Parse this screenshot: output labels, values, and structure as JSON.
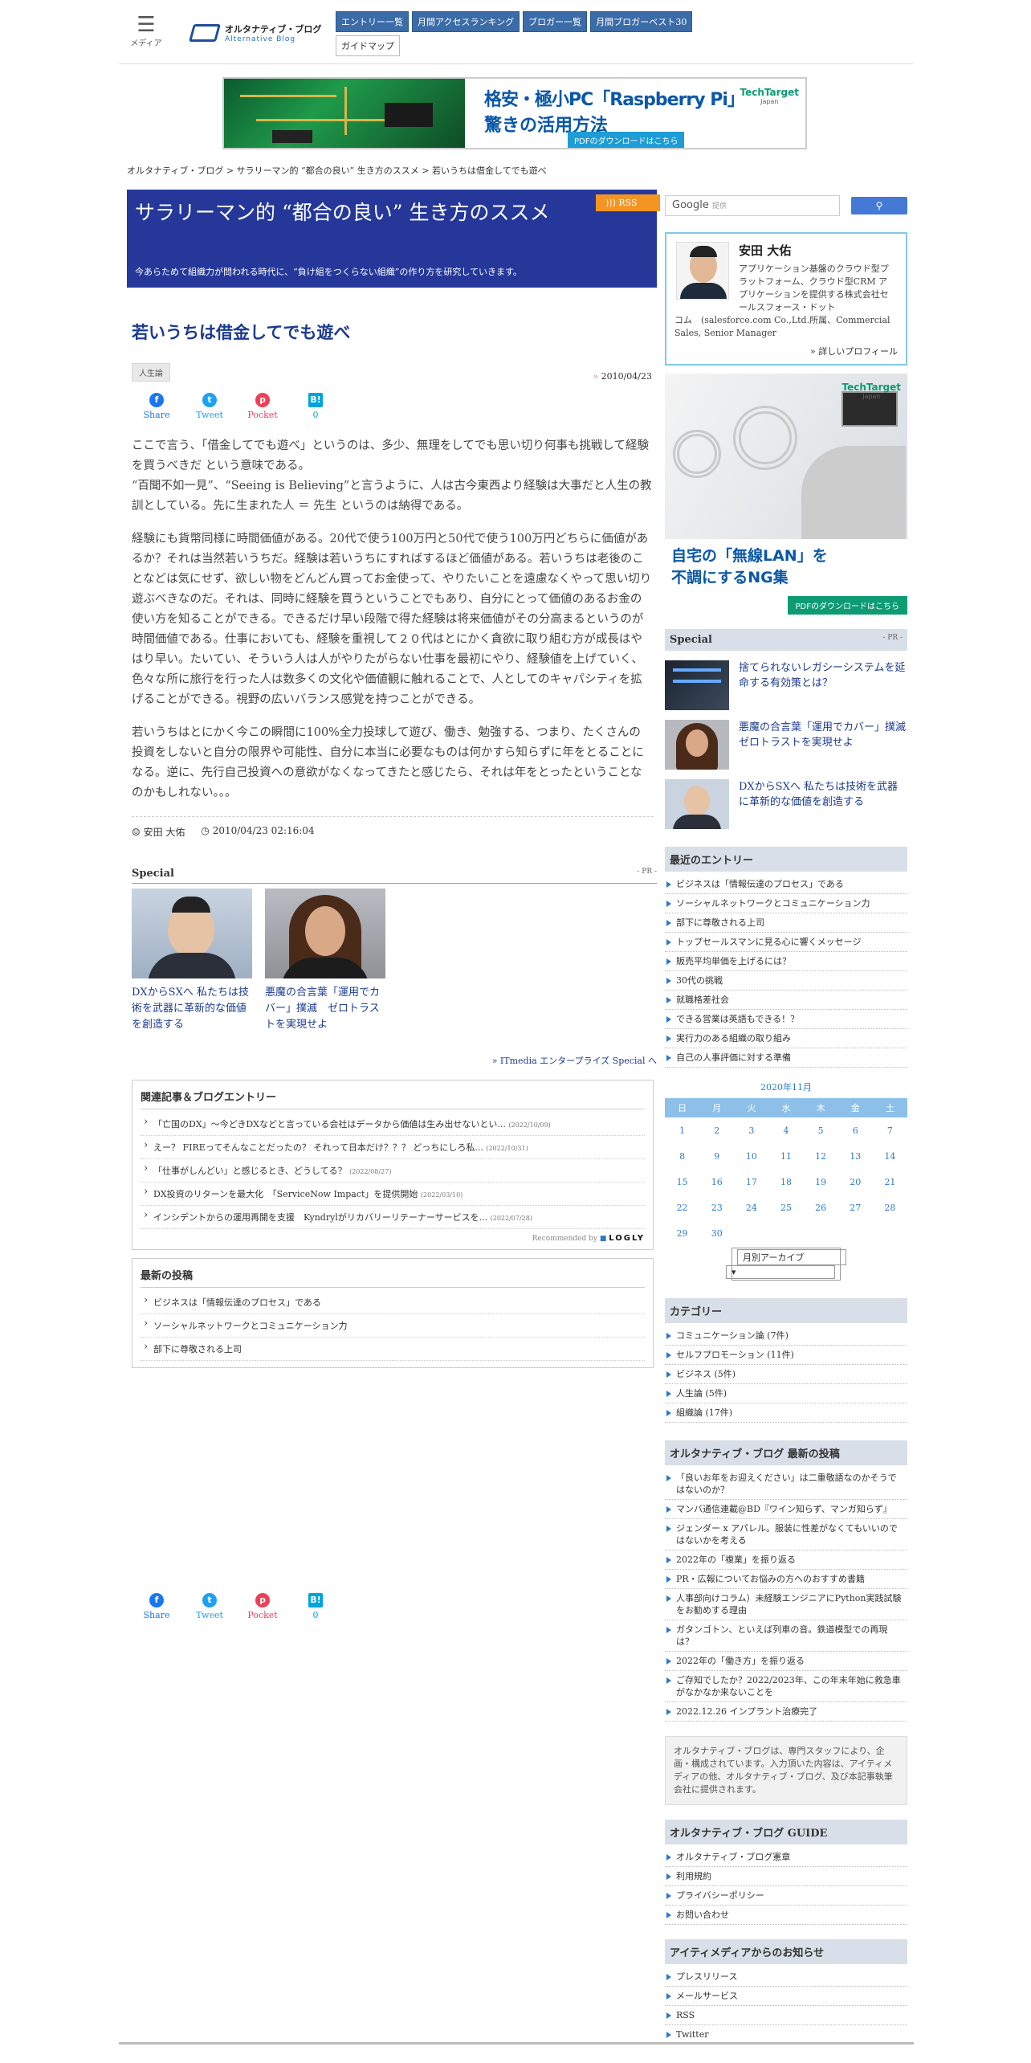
{
  "header": {
    "menu_label": "メディア",
    "logo_jp": "オルタナティブ・ブログ",
    "logo_en": "Alternative Blog",
    "nav": [
      {
        "label": "エントリー一覧"
      },
      {
        "label": "月間アクセスランキング"
      },
      {
        "label": "ブロガー一覧"
      },
      {
        "label": "月間ブロガーベスト30"
      },
      {
        "label": "ガイドマップ"
      }
    ]
  },
  "banner": {
    "line1": "格安・極小PC「Raspberry Pi」",
    "line2": "驚きの活用方法",
    "cta": "PDFのダウンロードはこちら",
    "brand": "TechTarget",
    "brand_sub": "Japan"
  },
  "breadcrumb": "オルタナティブ・ブログ > サラリーマン的 “都合の良い” 生き方のススメ > 若いうちは借金してでも遊べ",
  "blog": {
    "title": "サラリーマン的 “都合の良い” 生き方のススメ",
    "description": "今あらためて組織力が問われる時代に、“負け組をつくらない組織”の作り方を研究していきます。",
    "rss": "RSS"
  },
  "entry": {
    "title": "若いうちは借金してでも遊べ",
    "tag": "人生論",
    "date": "2010/04/23",
    "paragraphs": [
      "ここで言う、「借金してでも遊べ」というのは、多少、無理をしてでも思い切り何事も挑戦して経験を買うべきだ という意味である。\n“百聞不如一見”、“Seeing is Believing”と言うように、人は古今東西より経験は大事だと人生の教訓としている。先に生まれた人 ＝ 先生 というのは納得である。",
      "経験にも貨幣同様に時間価値がある。20代で使う100万円と50代で使う100万円どちらに価値があるか？それは当然若いうちだ。経験は若いうちにすればするほど価値がある。若いうちは老後のことなどは気にせず、欲しい物をどんどん買ってお金使って、やりたいことを遠慮なくやって思い切り遊ぶべきなのだ。それは、同時に経験を買うということでもあり、自分にとって価値のあるお金の使い方を知ることができる。できるだけ早い段階で得た経験は将来価値がその分高まるというのが時間価値である。仕事においても、経験を重視して２０代はとにかく貪欲に取り組む方が成長はやはり早い。たいてい、そういう人は人がやりたがらない仕事を最初にやり、経験値を上げていく、色々な所に旅行を行った人は数多くの文化や価値観に触れることで、人としてのキャパシティを拡げることができる。視野の広いバランス感覚を持つことができる。",
      "若いうちはとにかく今この瞬間に100%全力投球して遊び、働き、勉強する、つまり、たくさんの投資をしないと自分の限界や可能性、自分に本当に必要なものは何かすら知らずに年をとることになる。逆に、先行自己投資への意欲がなくなってきたと感じたら、それは年をとったということなのかもしれない。。。"
    ],
    "author": "安田 大佑",
    "timestamp": "2010/04/23 02:16:04"
  },
  "share": [
    {
      "label": "Share",
      "icon": "f",
      "color": "#1877f2"
    },
    {
      "label": "Tweet",
      "icon": "t",
      "color": "#1da1f2"
    },
    {
      "label": "Pocket",
      "icon": "p",
      "color": "#ef3f56"
    },
    {
      "label": "0",
      "icon": "B!",
      "color": "#00a4de"
    }
  ],
  "special": {
    "title": "Special",
    "pr": "- PR -",
    "items": [
      {
        "caption": "DXからSXへ 私たちは技術を武器に革新的な価値を創造する"
      },
      {
        "caption": "悪魔の合言葉「運用でカバー」撲滅　ゼロトラストを実現せよ"
      }
    ],
    "more": "» ITmedia エンタープライズ Special へ"
  },
  "related": {
    "title": "関連記事＆ブログエントリー",
    "items": [
      {
        "text": "「亡国のDX」～今どきDXなどと言っている会社はデータから価値は生み出せないとい...",
        "date": "(2022/10/09)"
      },
      {
        "text": "えー？ FIREってそんなことだったの？ それって日本だけ？？？ どっちにしろ私...",
        "date": "(2022/10/31)"
      },
      {
        "text": "「仕事がしんどい」と感じるとき、どうしてる？",
        "date": "(2022/08/27)"
      },
      {
        "text": "DX投資のリターンを最大化　「ServiceNow Impact」を提供開始",
        "date": "(2022/03/10)"
      },
      {
        "text": "インシデントからの運用再開を支援　Kyndrylがリカバリーリテーナーサービスを...",
        "date": "(2022/07/28)"
      }
    ],
    "recommended": "Recommended by",
    "logly": "LOGLY"
  },
  "latest": {
    "title": "最新の投稿",
    "items": [
      "ビジネスは「情報伝達のプロセス」である",
      "ソーシャルネットワークとコミュニケーション力",
      "部下に尊敬される上司"
    ]
  },
  "sidebar": {
    "search_brand": "Google",
    "search_hint": "提供",
    "search_button": "",
    "profile": {
      "name": "安田 大佑",
      "desc": "アプリケーション基盤のクラウド型プラットフォーム、クラウド型CRM アプリケーションを提供する株式会社セールスフォース・ドット",
      "desc2": "コム　(salesforce.com Co.,Ltd.所属、Commercial Sales, Senior Manager",
      "more": "» 詳しいプロフィール"
    },
    "ad": {
      "line1": "自宅の「無線LAN」を",
      "line2": "不調にするNG集",
      "cta": "PDFのダウンロードはこちら",
      "brand": "TechTarget",
      "brand_sub": "Japan"
    },
    "special": {
      "title": "Special",
      "pr": "- PR -",
      "items": [
        {
          "text": "捨てられないレガシーシステムを延命する有効策とは？"
        },
        {
          "text": "悪魔の合言葉「運用でカバー」撲滅　ゼロトラストを実現せよ"
        },
        {
          "text": "DXからSXへ 私たちは技術を武器に革新的な価値を創造する"
        }
      ]
    },
    "recent": {
      "title": "最近のエントリー",
      "items": [
        "ビジネスは「情報伝達のプロセス」である",
        "ソーシャルネットワークとコミュニケーション力",
        "部下に尊敬される上司",
        "トップセールスマンに見る心に響くメッセージ",
        "販売平均単価を上げるには？",
        "30代の挑戦",
        "就職格差社会",
        "できる営業は英語もできる！？",
        "実行力のある組織の取り組み",
        "自己の人事評価に対する準備"
      ]
    },
    "calendar": {
      "caption": "2020年11月",
      "days": [
        "日",
        "月",
        "火",
        "水",
        "木",
        "金",
        "土"
      ],
      "weeks": [
        [
          "1",
          "2",
          "3",
          "4",
          "5",
          "6",
          "7"
        ],
        [
          "8",
          "9",
          "10",
          "11",
          "12",
          "13",
          "14"
        ],
        [
          "15",
          "16",
          "17",
          "18",
          "19",
          "20",
          "21"
        ],
        [
          "22",
          "23",
          "24",
          "25",
          "26",
          "27",
          "28"
        ],
        [
          "29",
          "30",
          "",
          "",
          "",
          "",
          ""
        ]
      ],
      "archive": "月別アーカイブ"
    },
    "categories": {
      "title": "カテゴリー",
      "items": [
        "コミュニケーション論 (7件)",
        "セルフプロモーション (11件)",
        "ビジネス (5件)",
        "人生論 (5件)",
        "組織論 (17件)"
      ]
    },
    "blog_latest": {
      "title": "オルタナティブ・ブログ 最新の投稿",
      "items": [
        "「良いお年をお迎えください」は二重敬語なのかそうではないのか？",
        "マンバ通信連載@BD『ワイン知らず、マンガ知らず』",
        "ジェンダー x アパレル。服装に性差がなくてもいいのではないかを考える",
        "2022年の「複業」を振り返る",
        "PR・広報についてお悩みの方へのおすすめ書籍",
        "人事部向けコラム）未経験エンジニアにPython実践試験をお勧めする理由",
        "ガタンゴトン、といえば列車の音。鉄道模型での再現は？",
        "2022年の「働き方」を振り返る",
        "ご存知でしたか？2022/2023年、この年末年始に救急車がなかなか来ないことを",
        "2022.12.26 インプラント治療完了"
      ]
    },
    "note": "オルタナティブ・ブログは、専門スタッフにより、企画・構成されています。入力頂いた内容は、アイティメディアの他、オルタナティブ・ブログ、及び本記事執筆会社に提供されます。",
    "guide": {
      "title": "オルタナティブ・ブログ GUIDE",
      "items": [
        "オルタナティブ・ブログ憲章",
        "利用規約",
        "プライバシーポリシー",
        "お問い合わせ"
      ]
    },
    "itmedia": {
      "title": "アイティメディアからのお知らせ",
      "items": [
        "プレスリリース",
        "メールサービス",
        "RSS",
        "Twitter"
      ]
    }
  }
}
